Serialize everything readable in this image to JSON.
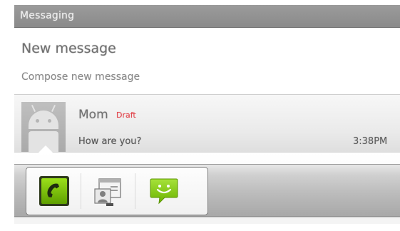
{
  "header": {
    "title": "Messaging"
  },
  "new_message": {
    "title": "New message",
    "subtitle": "Compose new message"
  },
  "thread": {
    "contact_name": "Mom",
    "draft_label": "Draft",
    "preview": "How are you?",
    "time": "3:38PM"
  },
  "quick_contact": {
    "actions": [
      {
        "name": "call",
        "icon": "phone-icon"
      },
      {
        "name": "contact card",
        "icon": "contact-card-icon"
      },
      {
        "name": "message",
        "icon": "sms-icon"
      }
    ]
  },
  "colors": {
    "title_bar": "#8a8a8a",
    "draft": "#e0454d",
    "action_green": "#7cc200"
  }
}
